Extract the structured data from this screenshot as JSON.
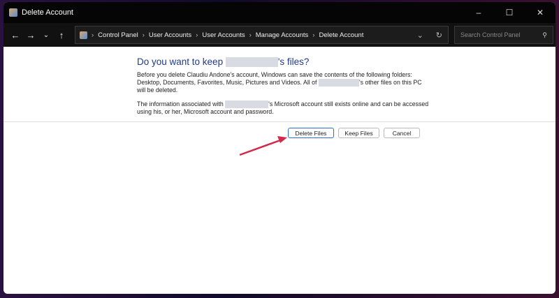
{
  "window": {
    "title": "Delete Account",
    "minimize": "–",
    "maximize": "☐",
    "close": "✕"
  },
  "nav": {
    "back": "←",
    "forward": "→",
    "recent": "⌄",
    "up": "↑"
  },
  "breadcrumb": [
    "Control Panel",
    "User Accounts",
    "User Accounts",
    "Manage Accounts",
    "Delete Account"
  ],
  "address": {
    "dropdown": "⌄",
    "refresh": "↻"
  },
  "search": {
    "placeholder": "Search Control Panel",
    "icon": "⚲"
  },
  "dialog": {
    "heading_pre": "Do you want to keep ",
    "heading_post": "'s files?",
    "p1_a": "Before you delete Claudiu Andone's account, Windows can save the contents of the following folders: Desktop, Documents, Favorites, Music, Pictures and Videos. All of ",
    "p1_b": "'s other files on this PC will be deleted.",
    "p2_a": "The information associated with ",
    "p2_b": "'s Microsoft account still exists online and can be accessed using his, or her, Microsoft account and password.",
    "buttons": {
      "delete": "Delete Files",
      "keep": "Keep Files",
      "cancel": "Cancel"
    }
  },
  "colors": {
    "heading": "#1f3a8f",
    "arrow": "#d42a4a"
  }
}
